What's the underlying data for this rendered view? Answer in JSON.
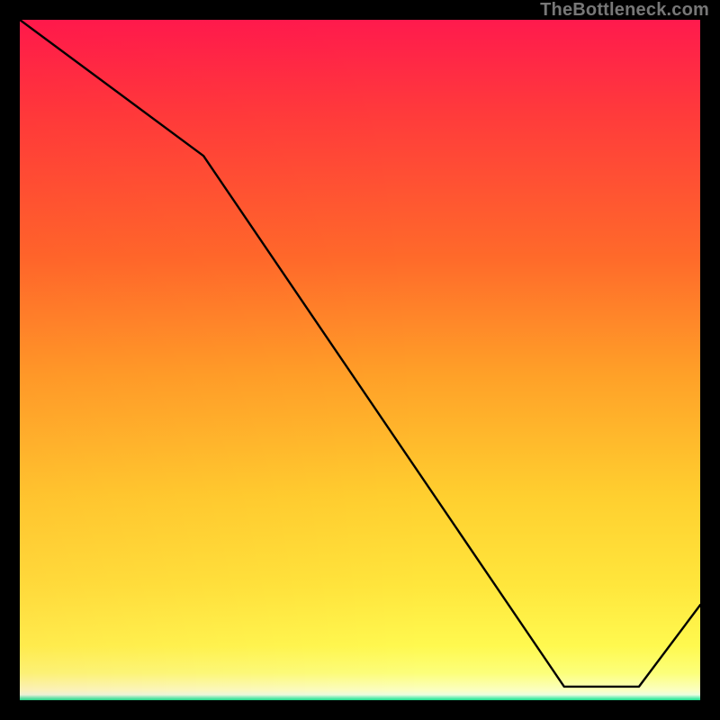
{
  "watermark": "TheBottleneck.com",
  "floor_label": "",
  "chart_data": {
    "type": "line",
    "title": "",
    "xlabel": "",
    "ylabel": "",
    "xlim": [
      0,
      100
    ],
    "ylim": [
      0,
      100
    ],
    "series": [
      {
        "name": "bottleneck-curve",
        "x": [
          0,
          27,
          80,
          91,
          100
        ],
        "y": [
          100,
          80,
          2,
          2,
          14
        ]
      }
    ],
    "annotations": [
      {
        "name": "floor-label",
        "x": 85,
        "y": 3,
        "text": ""
      }
    ],
    "background": {
      "vertical_gradient_anchor": "bottleneck-heatmap",
      "colors_top_to_bottom": [
        "#ff1a4d",
        "#ff6a2a",
        "#ffcf2f",
        "#fff94f",
        "#15e08a"
      ]
    }
  }
}
